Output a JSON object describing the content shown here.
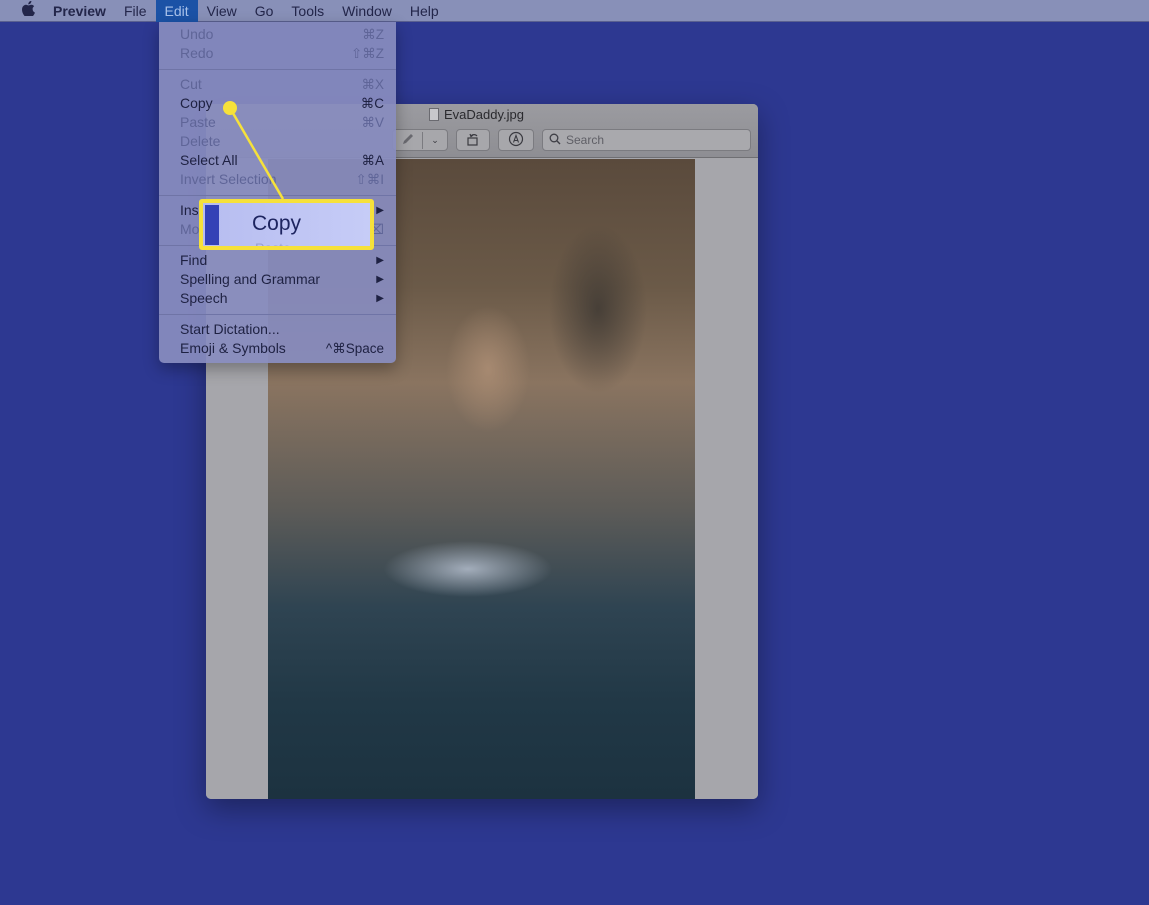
{
  "menubar": {
    "apple_icon": "apple-logo",
    "app_name": "Preview",
    "items": [
      "File",
      "Edit",
      "View",
      "Go",
      "Tools",
      "Window",
      "Help"
    ],
    "active": "Edit"
  },
  "edit_menu": {
    "groups": [
      [
        {
          "label": "Undo",
          "shortcut": "⌘Z",
          "enabled": false
        },
        {
          "label": "Redo",
          "shortcut": "⇧⌘Z",
          "enabled": false
        }
      ],
      [
        {
          "label": "Cut",
          "shortcut": "⌘X",
          "enabled": false
        },
        {
          "label": "Copy",
          "shortcut": "⌘C",
          "enabled": true
        },
        {
          "label": "Paste",
          "shortcut": "⌘V",
          "enabled": false
        },
        {
          "label": "Delete",
          "shortcut": "",
          "enabled": false
        },
        {
          "label": "Select All",
          "shortcut": "⌘A",
          "enabled": true
        },
        {
          "label": "Invert Selection",
          "shortcut": "⇧⌘I",
          "enabled": false
        }
      ],
      [
        {
          "label": "Insert",
          "shortcut": "▶",
          "enabled": true
        },
        {
          "label": "Move to Trash",
          "shortcut": "⌫",
          "enabled": false
        }
      ],
      [
        {
          "label": "Find",
          "shortcut": "▶",
          "enabled": true
        },
        {
          "label": "Spelling and Grammar",
          "shortcut": "▶",
          "enabled": true
        },
        {
          "label": "Speech",
          "shortcut": "▶",
          "enabled": true
        }
      ],
      [
        {
          "label": "Start Dictation...",
          "shortcut": "",
          "enabled": true
        },
        {
          "label": "Emoji & Symbols",
          "shortcut": "^⌘Space",
          "enabled": true
        }
      ]
    ]
  },
  "window": {
    "title": "EvaDaddy.jpg",
    "toolbar": {
      "markup_icon": "pencil-icon",
      "dropdown_icon": "chevron-down-icon",
      "rotate_icon": "rotate-icon",
      "annotate_icon": "markup-circle-icon",
      "search_placeholder": "Search"
    },
    "image_description": "Father and daughter splashing into a pool at the bottom of a water slide"
  },
  "callout": {
    "label": "Copy",
    "highlight_color": "#f6e13a"
  }
}
